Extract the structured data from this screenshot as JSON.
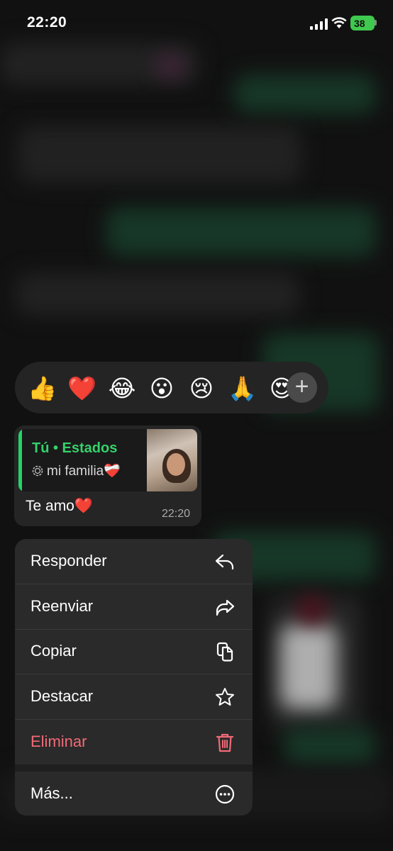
{
  "status_bar": {
    "time": "22:20",
    "battery": "38"
  },
  "reactions": {
    "emojis": [
      "👍",
      "❤️",
      "😂",
      "😮",
      "😢",
      "🙏",
      "😍"
    ],
    "more": "+"
  },
  "message": {
    "quote_title": "Tú • Estados",
    "quote_subtitle": "mi familia❤️‍🩹",
    "text": "Te amo❤️",
    "time": "22:20"
  },
  "menu": {
    "items": [
      {
        "label": "Responder",
        "icon": "reply-icon"
      },
      {
        "label": "Reenviar",
        "icon": "forward-icon"
      },
      {
        "label": "Copiar",
        "icon": "copy-icon"
      },
      {
        "label": "Destacar",
        "icon": "star-icon"
      },
      {
        "label": "Eliminar",
        "icon": "trash-icon"
      }
    ],
    "more": {
      "label": "Más...",
      "icon": "ellipsis-circle-icon"
    }
  },
  "colors": {
    "accent_green": "#24d366",
    "danger": "#f26a78"
  }
}
